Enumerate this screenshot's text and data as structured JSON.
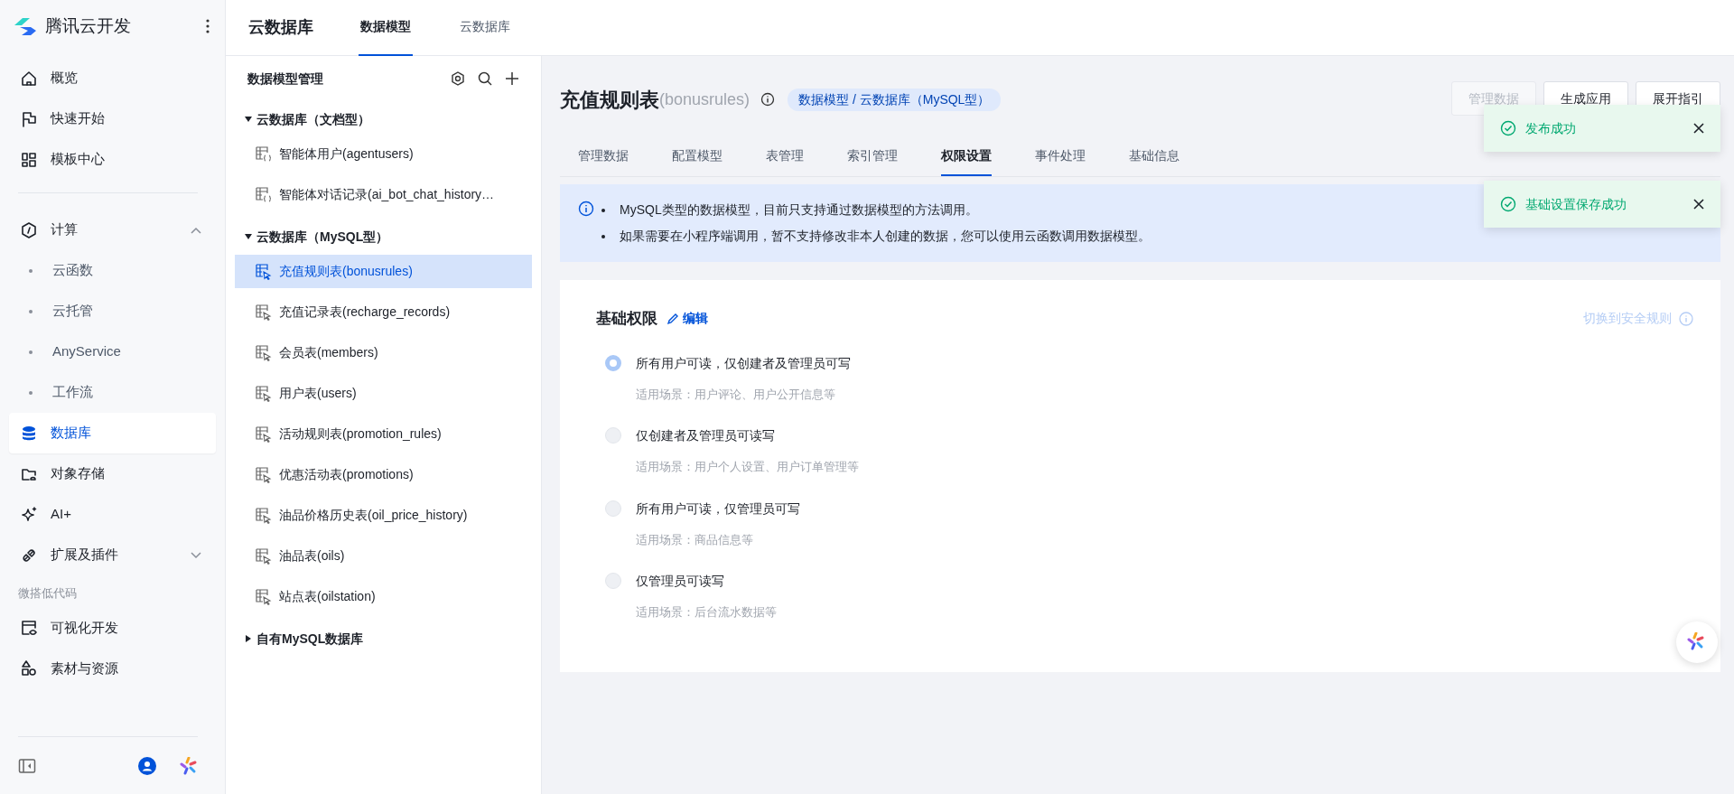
{
  "sidebar": {
    "brand": "腾讯云开发",
    "groups": [
      {
        "items": [
          {
            "label": "概览",
            "selected": false
          },
          {
            "label": "快速开始",
            "selected": false
          },
          {
            "label": "模板中心",
            "selected": false
          }
        ]
      },
      {
        "items": [
          {
            "label": "计算",
            "selected": false,
            "expanded": true,
            "children": [
              {
                "label": "云函数",
                "selected": false
              },
              {
                "label": "云托管",
                "selected": false
              },
              {
                "label": "AnyService",
                "selected": false
              },
              {
                "label": "工作流",
                "selected": false
              }
            ]
          },
          {
            "label": "数据库",
            "selected": true
          },
          {
            "label": "对象存储",
            "selected": false
          },
          {
            "label": "AI+",
            "selected": false
          },
          {
            "label": "扩展及插件",
            "selected": false,
            "expanded": false
          }
        ]
      },
      {
        "label": "微搭低代码",
        "items": [
          {
            "label": "可视化开发",
            "selected": false
          },
          {
            "label": "素材与资源",
            "selected": false
          }
        ]
      }
    ]
  },
  "header": {
    "title": "云数据库",
    "tabs": [
      {
        "label": "数据模型",
        "selected": true
      },
      {
        "label": "云数据库",
        "selected": false
      }
    ]
  },
  "tree": {
    "title": "数据模型管理",
    "groups": [
      {
        "label": "云数据库（文档型）",
        "kind": "document",
        "expanded": true,
        "items": [
          {
            "label": "智能体用户(agentusers)",
            "selected": false
          },
          {
            "label": "智能体对话记录(ai_bot_chat_history…",
            "selected": false
          }
        ]
      },
      {
        "label": "云数据库（MySQL型）",
        "kind": "mysql",
        "expanded": true,
        "items": [
          {
            "label": "充值规则表(bonusrules)",
            "selected": true
          },
          {
            "label": "充值记录表(recharge_records)",
            "selected": false
          },
          {
            "label": "会员表(members)",
            "selected": false
          },
          {
            "label": "用户表(users)",
            "selected": false
          },
          {
            "label": "活动规则表(promotion_rules)",
            "selected": false
          },
          {
            "label": "优惠活动表(promotions)",
            "selected": false
          },
          {
            "label": "油品价格历史表(oil_price_history)",
            "selected": false
          },
          {
            "label": "油品表(oils)",
            "selected": false
          },
          {
            "label": "站点表(oilstation)",
            "selected": false
          }
        ]
      },
      {
        "label": "自有MySQL数据库",
        "expanded": false
      }
    ]
  },
  "model": {
    "title": "充值规则表",
    "name": "(bonusrules)",
    "tag": "数据模型 / 云数据库（MySQL型）",
    "buttons": [
      {
        "label": "管理数据",
        "disabled": true
      },
      {
        "label": "生成应用",
        "disabled": false
      },
      {
        "label": "展开指引",
        "disabled": false
      }
    ],
    "tabs": [
      {
        "label": "管理数据",
        "selected": false
      },
      {
        "label": "配置模型",
        "selected": false
      },
      {
        "label": "表管理",
        "selected": false
      },
      {
        "label": "索引管理",
        "selected": false
      },
      {
        "label": "权限设置",
        "selected": true
      },
      {
        "label": "事件处理",
        "selected": false
      },
      {
        "label": "基础信息",
        "selected": false
      }
    ],
    "notice": [
      "MySQL类型的数据模型，目前只支持通过数据模型的方法调用。",
      "如果需要在小程序端调用，暂不支持修改非本人创建的数据，您可以使用云函数调用数据模型。"
    ],
    "permissions": {
      "title": "基础权限",
      "edit": "编辑",
      "switch": "切换到安全规则",
      "options": [
        {
          "label": "所有用户可读，仅创建者及管理员可写",
          "desc": "适用场景：用户评论、用户公开信息等",
          "selected": true
        },
        {
          "label": "仅创建者及管理员可读写",
          "desc": "适用场景：用户个人设置、用户订单管理等",
          "selected": false
        },
        {
          "label": "所有用户可读，仅管理员可写",
          "desc": "适用场景：商品信息等",
          "selected": false
        },
        {
          "label": "仅管理员可读写",
          "desc": "适用场景：后台流水数据等",
          "selected": false
        }
      ]
    }
  },
  "toasts": [
    {
      "text": "发布成功"
    },
    {
      "text": "基础设置保存成功"
    }
  ]
}
